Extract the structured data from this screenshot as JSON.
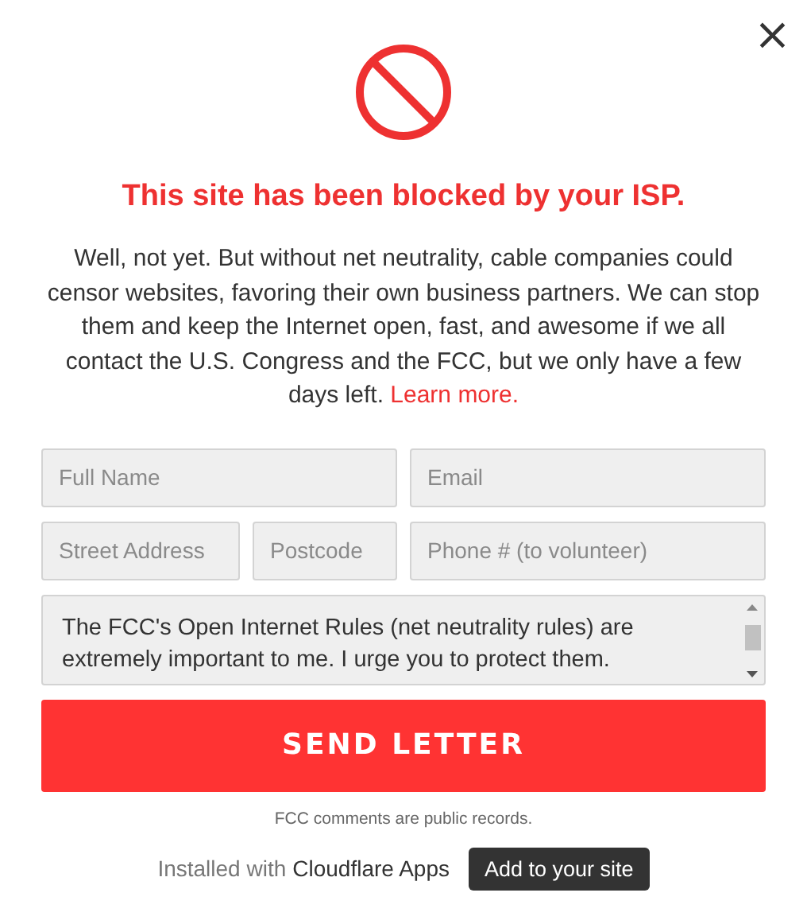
{
  "close": "×",
  "title": "This site has been blocked by your ISP.",
  "body": "Well, not yet. But without net neutrality, cable companies could censor websites, favoring their own business partners. We can stop them and keep the Internet open, fast, and awesome if we all contact the U.S. Congress and the FCC, but we only have a few days left.",
  "learn_more": "Learn more.",
  "fields": [
    {
      "placeholder": "Full Name"
    },
    {
      "placeholder": "Email"
    },
    {
      "placeholder": "Street Address"
    },
    {
      "placeholder": "Postcode"
    },
    {
      "placeholder": "Phone # (to volunteer)"
    }
  ],
  "message": {
    "value": "The FCC's Open Internet Rules (net neutrality rules) are extremely important to me. I urge you to protect them."
  },
  "send_button": "SEND LETTER",
  "note": "FCC comments are public records.",
  "footer": {
    "installed": "Installed with",
    "brand": "Cloudflare Apps",
    "add_button": "Add to your site"
  }
}
